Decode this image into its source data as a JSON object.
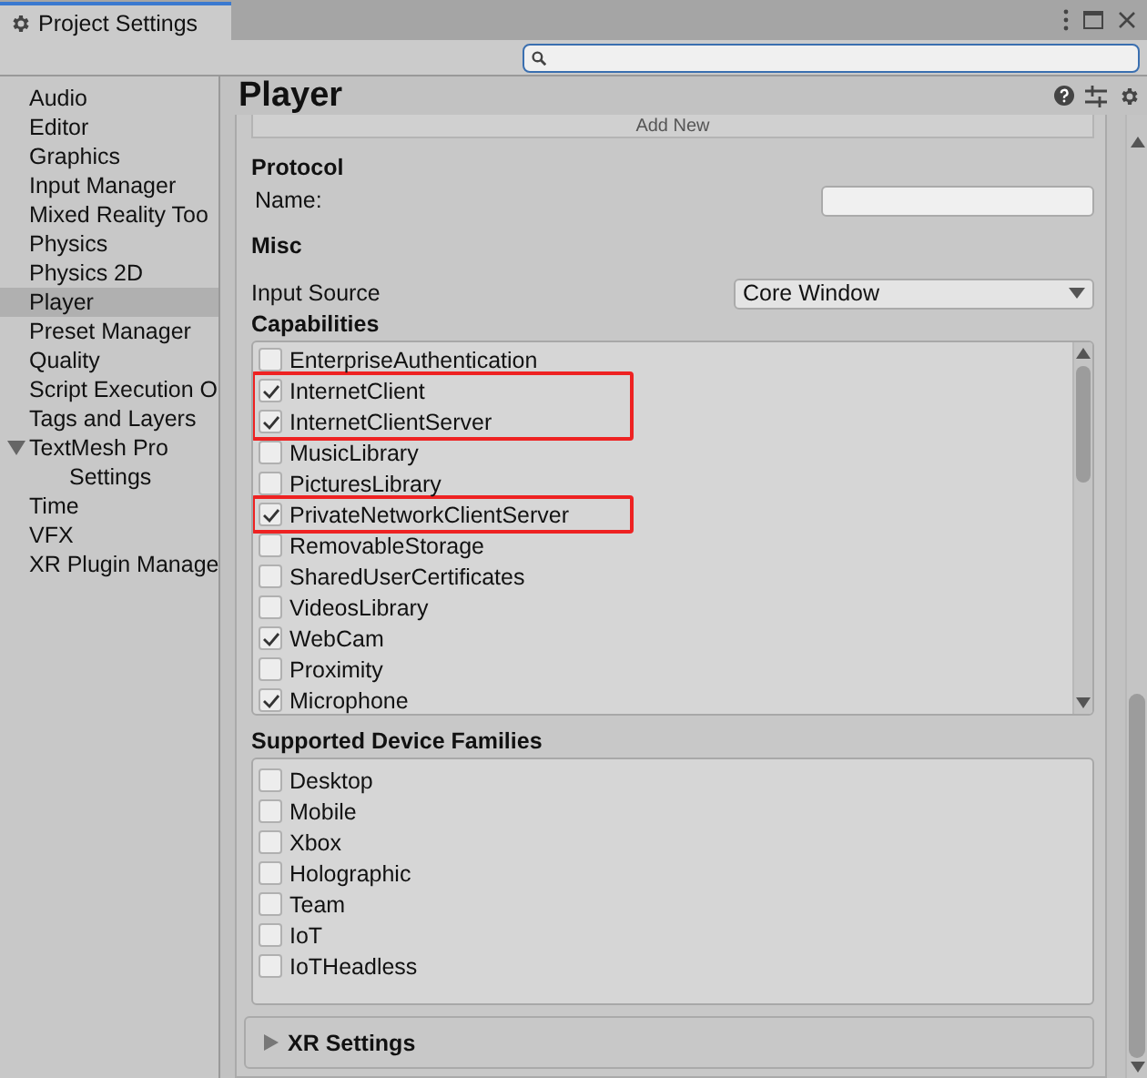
{
  "window": {
    "tab_title": "Project Settings"
  },
  "sidebar": {
    "items": [
      {
        "label": "Audio",
        "selected": false
      },
      {
        "label": "Editor",
        "selected": false
      },
      {
        "label": "Graphics",
        "selected": false
      },
      {
        "label": "Input Manager",
        "selected": false
      },
      {
        "label": "Mixed Reality Too",
        "selected": false
      },
      {
        "label": "Physics",
        "selected": false
      },
      {
        "label": "Physics 2D",
        "selected": false
      },
      {
        "label": "Player",
        "selected": true
      },
      {
        "label": "Preset Manager",
        "selected": false
      },
      {
        "label": "Quality",
        "selected": false
      },
      {
        "label": "Script Execution O",
        "selected": false
      },
      {
        "label": "Tags and Layers",
        "selected": false
      },
      {
        "label": "TextMesh Pro",
        "selected": false,
        "expanded": true,
        "children": [
          {
            "label": "Settings",
            "selected": false
          }
        ]
      },
      {
        "label": "Time",
        "selected": false
      },
      {
        "label": "VFX",
        "selected": false
      },
      {
        "label": "XR Plugin Manage",
        "selected": false
      }
    ]
  },
  "header": {
    "title": "Player"
  },
  "add_button": "Add New",
  "protocol": {
    "heading": "Protocol",
    "name_label": "Name:"
  },
  "misc": {
    "heading": "Misc",
    "input_source_label": "Input Source",
    "input_source_value": "Core Window"
  },
  "capabilities": {
    "heading": "Capabilities",
    "items": [
      {
        "label": "EnterpriseAuthentication",
        "checked": false,
        "highlighted": false
      },
      {
        "label": "InternetClient",
        "checked": true,
        "highlighted": true
      },
      {
        "label": "InternetClientServer",
        "checked": true,
        "highlighted": true
      },
      {
        "label": "MusicLibrary",
        "checked": false,
        "highlighted": false
      },
      {
        "label": "PicturesLibrary",
        "checked": false,
        "highlighted": false
      },
      {
        "label": "PrivateNetworkClientServer",
        "checked": true,
        "highlighted": true
      },
      {
        "label": "RemovableStorage",
        "checked": false,
        "highlighted": false
      },
      {
        "label": "SharedUserCertificates",
        "checked": false,
        "highlighted": false
      },
      {
        "label": "VideosLibrary",
        "checked": false,
        "highlighted": false
      },
      {
        "label": "WebCam",
        "checked": true,
        "highlighted": false
      },
      {
        "label": "Proximity",
        "checked": false,
        "highlighted": false
      },
      {
        "label": "Microphone",
        "checked": true,
        "highlighted": false
      }
    ]
  },
  "device_families": {
    "heading": "Supported Device Families",
    "items": [
      {
        "label": "Desktop",
        "checked": false
      },
      {
        "label": "Mobile",
        "checked": false
      },
      {
        "label": "Xbox",
        "checked": false
      },
      {
        "label": "Holographic",
        "checked": false
      },
      {
        "label": "Team",
        "checked": false
      },
      {
        "label": "IoT",
        "checked": false
      },
      {
        "label": "IoTHeadless",
        "checked": false
      }
    ]
  },
  "xr_settings": {
    "label": "XR Settings",
    "expanded": false
  }
}
